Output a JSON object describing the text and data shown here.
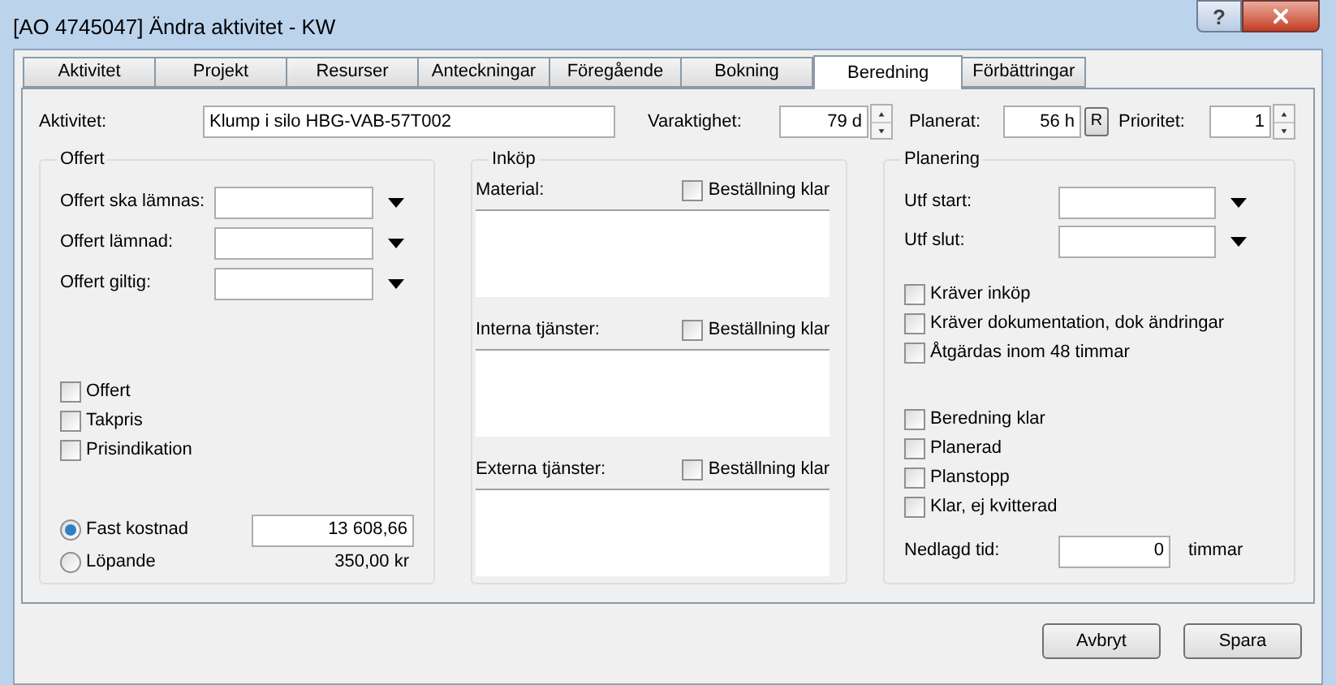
{
  "window": {
    "title": "[AO 4745047] Ändra aktivitet - KW",
    "help_button": "?"
  },
  "tabs": [
    {
      "label": "Aktivitet",
      "selected": false
    },
    {
      "label": "Projekt",
      "selected": false
    },
    {
      "label": "Resurser",
      "selected": false
    },
    {
      "label": "Anteckningar",
      "selected": false
    },
    {
      "label": "Föregående",
      "selected": false
    },
    {
      "label": "Bokning",
      "selected": false
    },
    {
      "label": "Beredning",
      "selected": true
    },
    {
      "label": "Förbättringar",
      "selected": false
    }
  ],
  "header": {
    "activity": {
      "label": "Aktivitet:",
      "value": "Klump i silo HBG-VAB-57T002"
    },
    "duration": {
      "label": "Varaktighet:",
      "value": "79 d"
    },
    "planned": {
      "label": "Planerat:",
      "value": "56 h",
      "button": "R"
    },
    "priority": {
      "label": "Prioritet:",
      "value": "1"
    }
  },
  "offert": {
    "title": "Offert",
    "date_fields": [
      {
        "label": "Offert ska lämnas:"
      },
      {
        "label": "Offert lämnad:"
      },
      {
        "label": "Offert giltig:"
      }
    ],
    "checkboxes": [
      {
        "label": "Offert",
        "checked": false
      },
      {
        "label": "Takpris",
        "checked": false
      },
      {
        "label": "Prisindikation",
        "checked": false
      }
    ],
    "pricing": [
      {
        "label": "Fast kostnad",
        "selected": true,
        "kind": "field",
        "value": "13 608,66"
      },
      {
        "label": "Löpande",
        "selected": false,
        "kind": "text",
        "value": "350,00 kr"
      }
    ]
  },
  "inkop": {
    "title": "Inköp",
    "sections": [
      {
        "label": "Material:",
        "checkbox": {
          "label": "Beställning klar",
          "checked": false
        }
      },
      {
        "label": "Interna tjänster:",
        "checkbox": {
          "label": "Beställning klar",
          "checked": false
        }
      },
      {
        "label": "Externa tjänster:",
        "checkbox": {
          "label": "Beställning klar",
          "checked": false
        }
      }
    ]
  },
  "planering": {
    "title": "Planering",
    "date_fields": [
      {
        "label": "Utf start:"
      },
      {
        "label": "Utf slut:"
      }
    ],
    "checkbox_groups": [
      [
        {
          "label": "Kräver inköp",
          "checked": false
        },
        {
          "label": "Kräver dokumentation, dok ändringar",
          "checked": false
        },
        {
          "label": "Åtgärdas inom 48 timmar",
          "checked": false
        }
      ],
      [
        {
          "label": "Beredning klar",
          "checked": false
        },
        {
          "label": "Planerad",
          "checked": false
        },
        {
          "label": "Planstopp",
          "checked": false
        },
        {
          "label": "Klar, ej kvitterad",
          "checked": false
        }
      ]
    ],
    "time_spent": {
      "label": "Nedlagd tid:",
      "value": "0",
      "unit": "timmar"
    }
  },
  "buttons": [
    "Avbryt",
    "Spara"
  ]
}
